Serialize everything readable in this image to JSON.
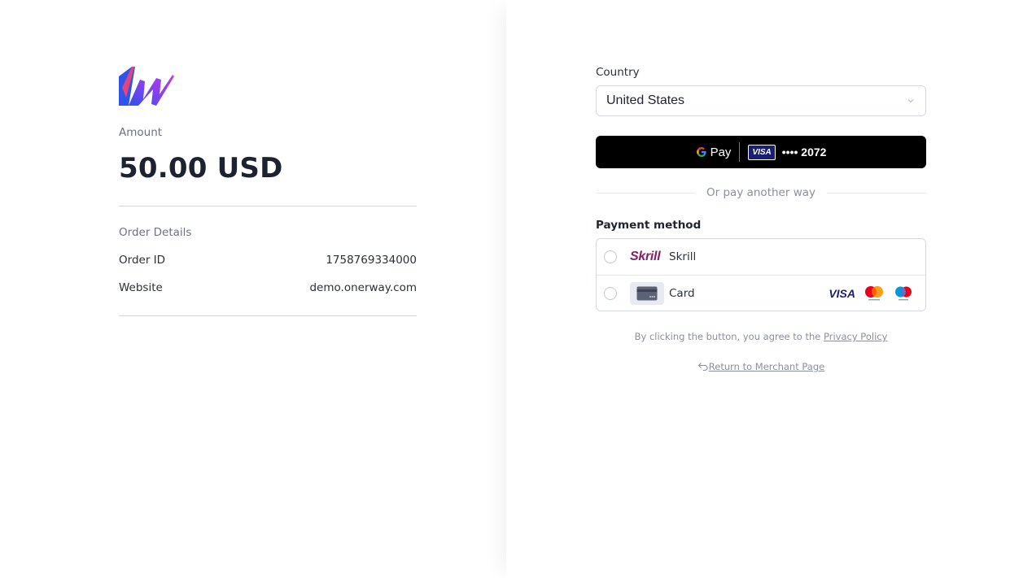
{
  "summary": {
    "amount_label": "Amount",
    "amount_value": "50.00 USD",
    "order_details_title": "Order Details",
    "rows": [
      {
        "label": "Order ID",
        "value": "1758769334000"
      },
      {
        "label": "Website",
        "value": "demo.onerway.com"
      }
    ]
  },
  "checkout": {
    "country_label": "Country",
    "country_value": "United States",
    "gpay": {
      "pay_word": "Pay",
      "card_brand": "VISA",
      "card_digits": "•••• 2072"
    },
    "divider_text": "Or pay another way",
    "payment_method_label": "Payment method",
    "methods": [
      {
        "name": "Skrill",
        "logo_text": "Skrill",
        "icon": "skrill-logo"
      },
      {
        "name": "Card",
        "icon": "credit-card-icon",
        "brands": [
          "visa",
          "mastercard",
          "maestro"
        ]
      }
    ],
    "visa_brand_text": "VISA",
    "terms_prefix": "By clicking the button, you agree to the ",
    "privacy_link": "Privacy Policy",
    "return_link": "Return to Merchant Page"
  },
  "colors": {
    "brand_purple": "#7b3fe4",
    "brand_blue": "#2f54eb",
    "skrill": "#862165",
    "visa": "#1a1f71",
    "mastercard_red": "#eb001b",
    "mastercard_yellow": "#f79e1b",
    "maestro_blue": "#0099df"
  }
}
